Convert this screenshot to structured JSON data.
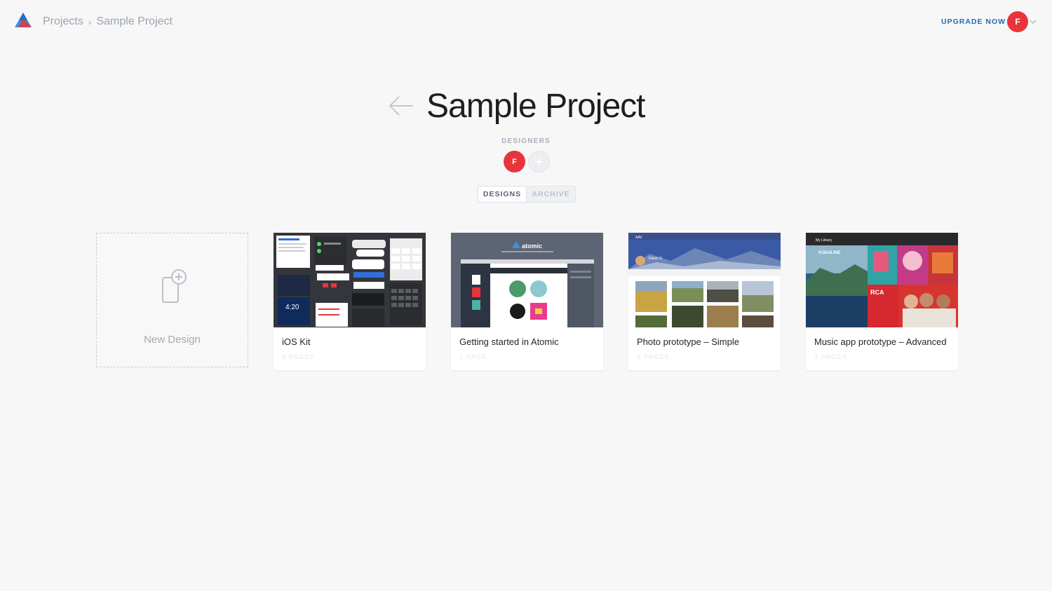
{
  "topbar": {
    "breadcrumb": [
      "Projects",
      "Sample Project"
    ],
    "upgrade_label": "UPGRADE NOW",
    "user_initial": "F"
  },
  "header": {
    "title": "Sample Project",
    "designers_label": "DESIGNERS",
    "designers": [
      "F"
    ],
    "add_designer_symbol": "+"
  },
  "tabs": [
    {
      "label": "DESIGNS",
      "active": true
    },
    {
      "label": "ARCHIVE",
      "active": false
    }
  ],
  "new_design_label": "New Design",
  "designs": [
    {
      "title": "iOS Kit",
      "pages": "2 PAGES"
    },
    {
      "title": "Getting started in Atomic",
      "pages": "1 PAGE",
      "thumb_brand": "atomic"
    },
    {
      "title": "Photo prototype – Simple",
      "pages": "2 PAGES",
      "thumb_name": "Eileen S."
    },
    {
      "title": "Music app prototype – Advanced",
      "pages": "2 PAGES",
      "thumb_header": "My Library",
      "thumb_artists": [
        "KODALINE",
        "RCA"
      ]
    }
  ],
  "colors": {
    "accent_blue": "#1f6bb5",
    "avatar_red": "#e8353c",
    "background": "#f7f7f7"
  },
  "icons": [
    "atomic-logo-icon",
    "chevron-right-icon",
    "chevron-down-icon",
    "back-arrow-icon",
    "add-page-icon"
  ]
}
